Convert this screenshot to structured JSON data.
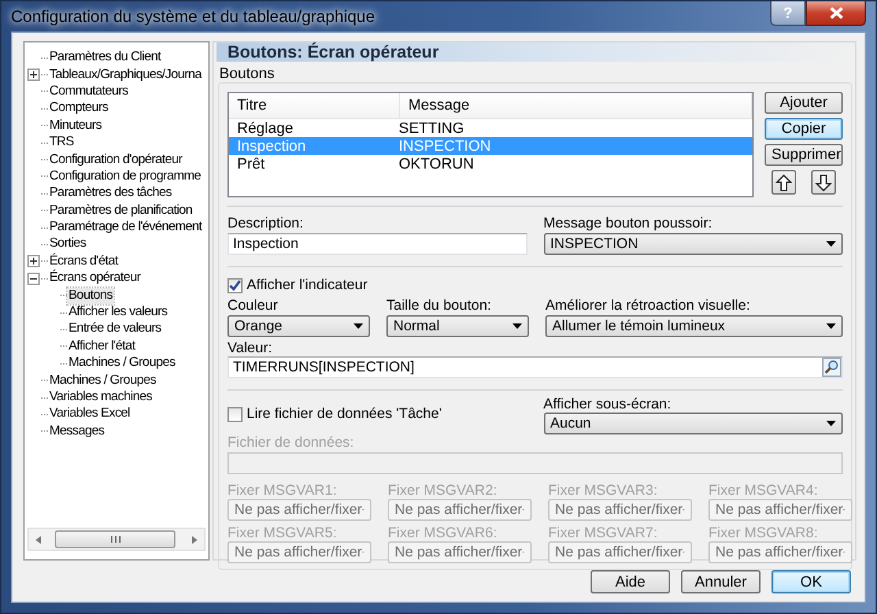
{
  "window": {
    "title": "Configuration du système et du tableau/graphique",
    "help_button": "?"
  },
  "tree": {
    "items": [
      {
        "label": "Paramètres du Client",
        "selected": false
      },
      {
        "label": "Tableaux/Graphiques/Journa",
        "selected": false,
        "expanded": false
      },
      {
        "label": "Commutateurs",
        "selected": false
      },
      {
        "label": "Compteurs",
        "selected": false
      },
      {
        "label": "Minuteurs",
        "selected": false
      },
      {
        "label": "TRS",
        "selected": false
      },
      {
        "label": "Configuration d'opérateur",
        "selected": false
      },
      {
        "label": "Configuration de programme",
        "selected": false
      },
      {
        "label": "Paramètres des tâches",
        "selected": false
      },
      {
        "label": "Paramètres de planification",
        "selected": false
      },
      {
        "label": "Paramétrage de l'événement",
        "selected": false
      },
      {
        "label": "Sorties",
        "selected": false
      },
      {
        "label": "Écrans d'état",
        "selected": false,
        "expanded": false
      },
      {
        "label": "Écrans opérateur",
        "selected": false,
        "expanded": true,
        "children": [
          {
            "label": "Boutons",
            "selected": true
          },
          {
            "label": "Afficher les valeurs",
            "selected": false
          },
          {
            "label": "Entrée de valeurs",
            "selected": false
          },
          {
            "label": "Afficher l'état",
            "selected": false
          },
          {
            "label": "Machines / Groupes",
            "selected": false
          }
        ]
      },
      {
        "label": "Machines / Groupes",
        "selected": false
      },
      {
        "label": "Variables machines",
        "selected": false
      },
      {
        "label": "Variables Excel",
        "selected": false
      },
      {
        "label": "Messages",
        "selected": false
      }
    ]
  },
  "panel": {
    "title": "Boutons: Écran opérateur",
    "group_label": "Boutons",
    "table": {
      "columns": [
        "Titre",
        "Message"
      ],
      "rows": [
        {
          "cells": [
            "Réglage",
            "SETTING"
          ],
          "selected": false
        },
        {
          "cells": [
            "Inspection",
            "INSPECTION"
          ],
          "selected": true
        },
        {
          "cells": [
            "Prêt",
            "OKTORUN"
          ],
          "selected": false
        }
      ]
    },
    "side_buttons": [
      {
        "label": "Ajouter",
        "focused": false
      },
      {
        "label": "Copier",
        "focused": true
      },
      {
        "label": "Supprimer",
        "focused": false
      }
    ],
    "description": {
      "label": "Description:",
      "value": "Inspection"
    },
    "push_message": {
      "label": "Message bouton poussoir:",
      "value": "INSPECTION"
    },
    "show_indicator": {
      "label": "Afficher l'indicateur",
      "checked": true
    },
    "color": {
      "label": "Couleur",
      "value": "Orange"
    },
    "size": {
      "label": "Taille du bouton:",
      "value": "Normal"
    },
    "feedback": {
      "label": "Améliorer la rétroaction visuelle:",
      "value": "Allumer le témoin lumineux"
    },
    "value": {
      "label": "Valeur:",
      "value": "TIMERRUNS[INSPECTION]"
    },
    "read_task_file": {
      "label": "Lire fichier de données 'Tâche'",
      "checked": false
    },
    "sub_screen": {
      "label": "Afficher sous-écran:",
      "value": "Aucun"
    },
    "data_file": {
      "label": "Fichier de données:",
      "disabled": true
    },
    "msgvars": [
      {
        "label": "Fixer MSGVAR1:",
        "value": "Ne pas afficher/fixer",
        "disabled": true
      },
      {
        "label": "Fixer MSGVAR2:",
        "value": "Ne pas afficher/fixer",
        "disabled": true
      },
      {
        "label": "Fixer MSGVAR3:",
        "value": "Ne pas afficher/fixer",
        "disabled": true
      },
      {
        "label": "Fixer MSGVAR4:",
        "value": "Ne pas afficher/fixer",
        "disabled": true
      },
      {
        "label": "Fixer MSGVAR5:",
        "value": "Ne pas afficher/fixer",
        "disabled": true
      },
      {
        "label": "Fixer MSGVAR6:",
        "value": "Ne pas afficher/fixer",
        "disabled": true
      },
      {
        "label": "Fixer MSGVAR7:",
        "value": "Ne pas afficher/fixer",
        "disabled": true
      },
      {
        "label": "Fixer MSGVAR8:",
        "value": "Ne pas afficher/fixer",
        "disabled": true
      }
    ]
  },
  "footer_buttons": [
    {
      "label": "Aide",
      "default": false
    },
    {
      "label": "Annuler",
      "default": false
    },
    {
      "label": "OK",
      "default": true
    }
  ]
}
